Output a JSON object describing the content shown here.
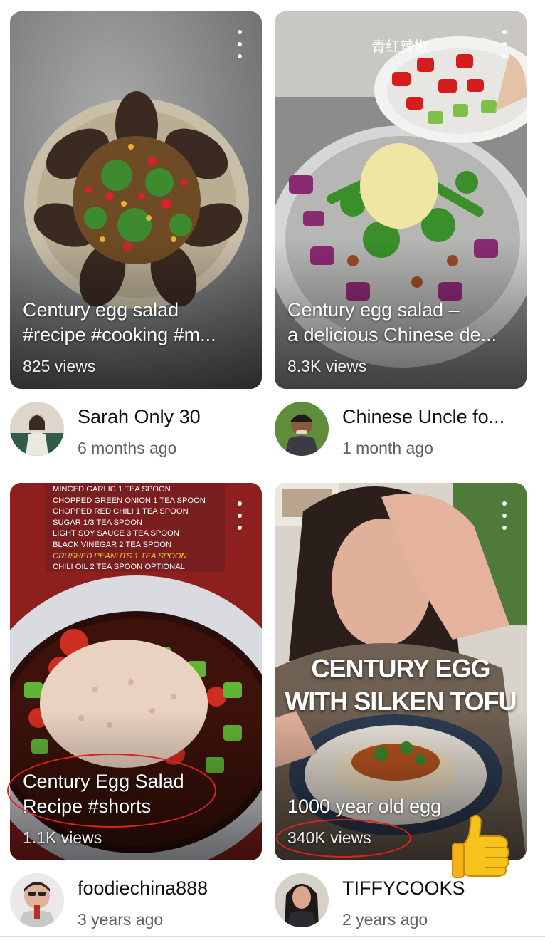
{
  "cards": [
    {
      "title_lines": [
        "Century egg salad",
        "#recipe #cooking  #m..."
      ],
      "views": "825 views",
      "channel": "Sarah Only 30",
      "age": "6 months ago"
    },
    {
      "title_lines": [
        "Century egg salad –",
        "a delicious Chinese de..."
      ],
      "views": "8.3K views",
      "channel": "Chinese Uncle fo...",
      "age": "1 month ago",
      "overlay_caption": "青红辣椒"
    },
    {
      "title_lines": [
        "Century Egg Salad",
        "Recipe #shorts"
      ],
      "views": "1.1K views",
      "channel": "foodiechina888",
      "age": "3 years ago",
      "ingredients": [
        "MINCED GARLIC 1 TEA SPOON",
        "CHOPPED GREEN ONION 1 TEA SPOON",
        "CHOPPED RED CHILI 1 TEA SPOON",
        "SUGAR 1/3 TEA SPOON",
        "LIGHT SOY SAUCE 3 TEA SPOON",
        "BLACK VINEGAR 2 TEA SPOON",
        "CRUSHED PEANUTS 1 TEA SPOON",
        "CHILI OIL 2 TEA SPOON OPTIONAL"
      ]
    },
    {
      "title_lines": [
        "1000 year old egg"
      ],
      "views": "340K views",
      "channel": "TIFFYCOOKS",
      "age": "2 years ago",
      "overlay_heading": [
        "CENTURY EGG",
        "WITH SILKEN TOFU"
      ]
    }
  ],
  "colors": {
    "annotation": "#e0201c",
    "thumbs_up": "#f7c21c"
  },
  "icons": {
    "menu": "more-vert-icon",
    "reaction": "thumbs-up-icon"
  }
}
